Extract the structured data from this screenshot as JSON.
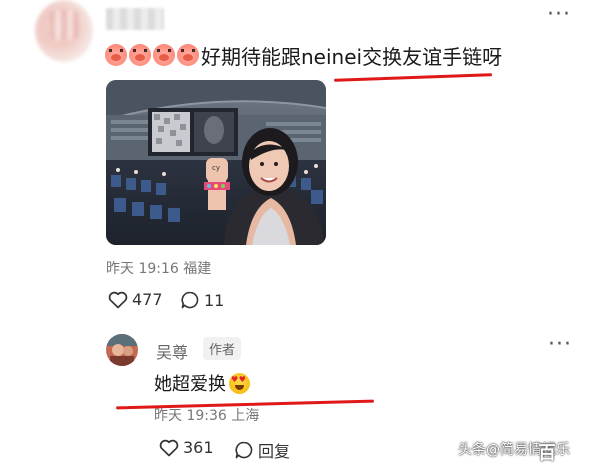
{
  "top_comment": {
    "text": "好期待能跟neinei交换友谊手链呀",
    "emoji_icon": "pig-face-icon",
    "emoji_count": 4,
    "meta": "昨天 19:16 福建",
    "likes": "477",
    "comments": "11"
  },
  "reply": {
    "author": "吴尊",
    "badge": "作者",
    "text": "她超爱换",
    "emoji_icon": "heart-eyes-icon",
    "meta": "昨天 19:36 上海",
    "likes": "361",
    "reply_label": "回复"
  },
  "watermark": {
    "text": "头条@简易情娱乐",
    "mark": "百"
  },
  "colors": {
    "underline": "#e01818",
    "meta_text": "#777777",
    "body_text": "#1a1a1a"
  }
}
